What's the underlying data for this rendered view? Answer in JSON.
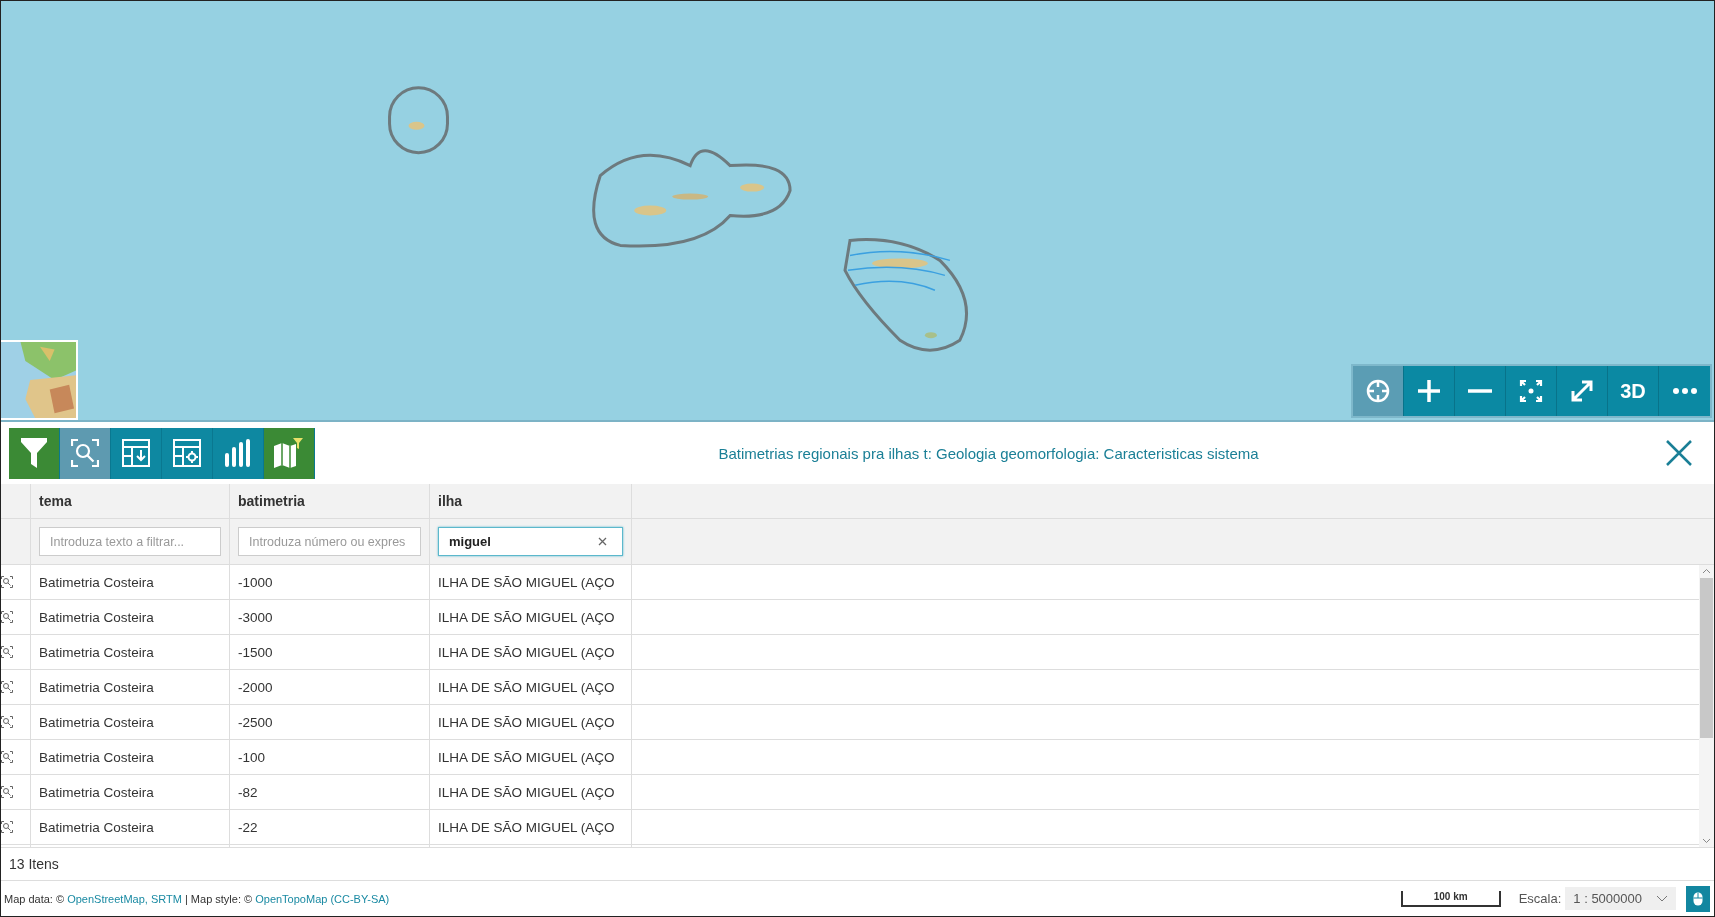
{
  "map": {
    "kind": "picture",
    "controls": [
      {
        "kind": "locate",
        "selected": true
      },
      {
        "kind": "zoom-in",
        "selected": false
      },
      {
        "kind": "zoom-out",
        "selected": false
      },
      {
        "kind": "fit-extent",
        "selected": false
      },
      {
        "kind": "fullscreen",
        "selected": false
      },
      {
        "kind": "threed",
        "label": "3D",
        "selected": false
      },
      {
        "kind": "more",
        "selected": false
      }
    ]
  },
  "toolbar": {
    "buttons": [
      {
        "kind": "filter",
        "selected": false
      },
      {
        "kind": "zoom-to",
        "selected": true
      },
      {
        "kind": "export-table",
        "selected": false
      },
      {
        "kind": "table-settings",
        "selected": false
      },
      {
        "kind": "chart",
        "selected": false
      },
      {
        "kind": "map-filter",
        "selected": false
      }
    ],
    "title": "Batimetrias regionais pra ilhas t: Geologia geomorfologia: Caracteristicas sistema"
  },
  "table": {
    "columns": [
      {
        "label": "tema",
        "filter_placeholder": "Introduza texto a filtrar..."
      },
      {
        "label": "batimetria",
        "filter_placeholder": "Introduza número ou expres"
      },
      {
        "label": "ilha",
        "filter_value": "miguel"
      }
    ],
    "rows": [
      [
        "Batimetria Costeira",
        "-1000",
        "ILHA DE SÃO MIGUEL (AÇO"
      ],
      [
        "Batimetria Costeira",
        "-3000",
        "ILHA DE SÃO MIGUEL (AÇO"
      ],
      [
        "Batimetria Costeira",
        "-1500",
        "ILHA DE SÃO MIGUEL (AÇO"
      ],
      [
        "Batimetria Costeira",
        "-2000",
        "ILHA DE SÃO MIGUEL (AÇO"
      ],
      [
        "Batimetria Costeira",
        "-2500",
        "ILHA DE SÃO MIGUEL (AÇO"
      ],
      [
        "Batimetria Costeira",
        "-100",
        "ILHA DE SÃO MIGUEL (AÇO"
      ],
      [
        "Batimetria Costeira",
        "-82",
        "ILHA DE SÃO MIGUEL (AÇO"
      ],
      [
        "Batimetria Costeira",
        "-22",
        "ILHA DE SÃO MIGUEL (AÇO"
      ]
    ],
    "count": "13 Itens"
  },
  "status_bar": {
    "attribution": [
      {
        "kind": "text",
        "text": "Map data: © "
      },
      {
        "kind": "link",
        "text": "OpenStreetMap, SRTM"
      },
      {
        "kind": "text",
        "text": " | Map style: © "
      },
      {
        "kind": "link",
        "text": "OpenTopoMap"
      },
      {
        "kind": "link",
        "text": "(CC-BY-SA)"
      }
    ],
    "scale_bar": "100 km",
    "scale_label": "Escala:",
    "scale_value": "1 : 5000000"
  }
}
